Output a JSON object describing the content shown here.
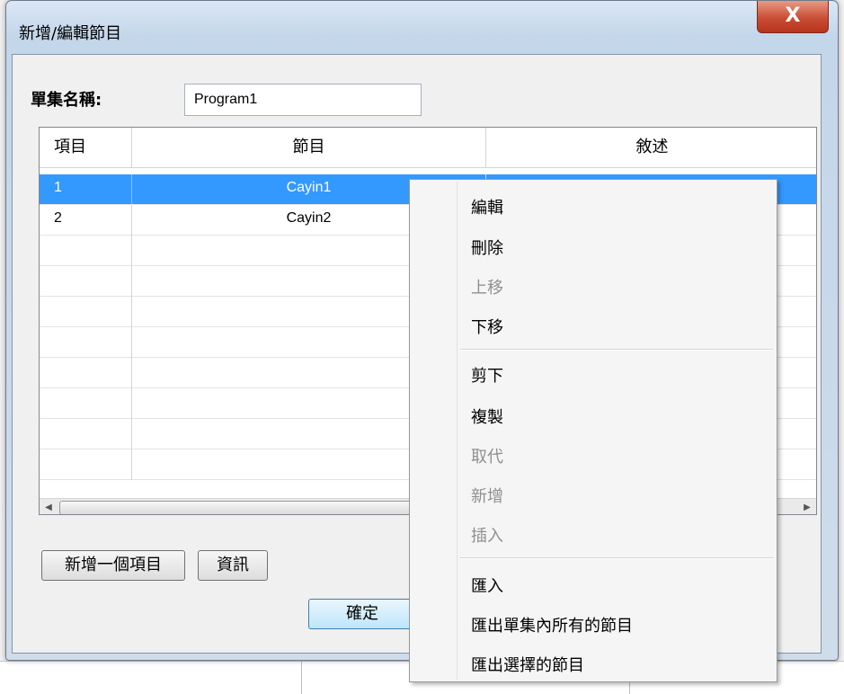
{
  "dialog": {
    "title": "新增/編輯節目",
    "close_label": "X",
    "name_label": "單集名稱:",
    "name_value": "Program1"
  },
  "table": {
    "headers": [
      "項目",
      "節目",
      "敘述"
    ],
    "rows": [
      {
        "item": "1",
        "program": "Cayin1",
        "desc": ""
      },
      {
        "item": "2",
        "program": "Cayin2",
        "desc": ""
      }
    ],
    "selected_row": 0
  },
  "scrollbar": {
    "left_arrow": "◀",
    "right_arrow": "▶"
  },
  "buttons": {
    "add_item": "新增一個項目",
    "info": "資訊",
    "ok": "確定"
  },
  "context_menu": {
    "items": [
      {
        "label": "編輯",
        "enabled": true
      },
      {
        "label": "刪除",
        "enabled": true
      },
      {
        "label": "上移",
        "enabled": false
      },
      {
        "label": "下移",
        "enabled": true
      },
      {
        "label": "剪下",
        "enabled": true
      },
      {
        "label": "複製",
        "enabled": true
      },
      {
        "label": "取代",
        "enabled": false
      },
      {
        "label": "新增",
        "enabled": false
      },
      {
        "label": "插入",
        "enabled": false
      },
      {
        "label": "匯入",
        "enabled": true
      },
      {
        "label": "匯出單集內所有的節目",
        "enabled": true
      },
      {
        "label": "匯出選擇的節目",
        "enabled": true
      }
    ]
  },
  "colors": {
    "selection": "#3399ff",
    "close_button": "#c94d35"
  }
}
